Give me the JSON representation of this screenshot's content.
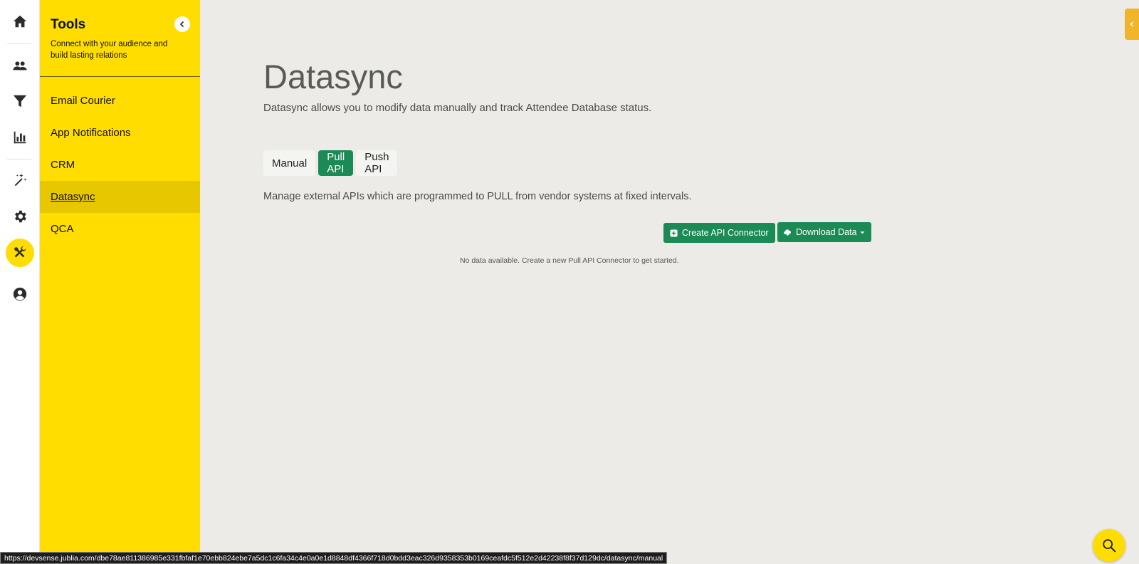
{
  "rail": {
    "items": [
      "home-icon",
      "users-icon",
      "funnel-icon",
      "bar-chart-icon",
      "magic-wand-icon",
      "gear-icon",
      "tools-icon",
      "account-icon"
    ],
    "active": "tools-icon"
  },
  "tools_panel": {
    "title": "Tools",
    "subtitle": "Connect with your audience and build lasting relations",
    "menu": [
      {
        "label": "Email Courier"
      },
      {
        "label": "App Notifications"
      },
      {
        "label": "CRM"
      },
      {
        "label": "Datasync"
      },
      {
        "label": "QCA"
      }
    ],
    "active_item": "Datasync"
  },
  "main": {
    "title": "Datasync",
    "description": "Datasync allows you to modify data manually and track Attendee Database status.",
    "tabs": [
      {
        "label": "Manual"
      },
      {
        "label": "Pull API"
      },
      {
        "label": "Push API"
      }
    ],
    "active_tab": "Pull API",
    "tab_description": "Manage external APIs which are programmed to PULL from vendor systems at fixed intervals.",
    "create_button": "Create API Connector",
    "download_button": "Download Data",
    "empty_message": "No data available. Create a new Pull API Connector to get started."
  },
  "status_url": "https://devsense.jublia.com/dbe78ae811386985e331fbfaf1e70ebb824ebe7a5dc1c6fa34c4e0a0e1d8848df4366f718d0bdd3eac326d9358353b0169ceafdc5f512e2d42238f8f37d129dc/datasync/manual",
  "colors": {
    "accent_yellow": "#ffdd00",
    "active_yellow": "#e6c700",
    "green": "#1b8a55",
    "background": "#ecebe7",
    "side_tab": "#f1b52b"
  }
}
